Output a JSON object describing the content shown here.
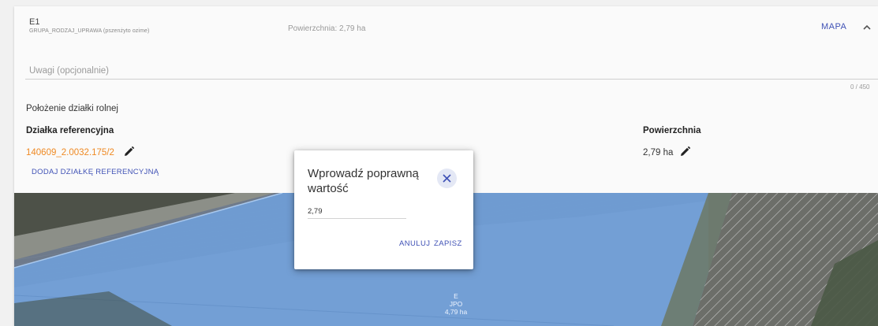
{
  "header": {
    "parcel_id": "E1",
    "group_crop": "GRUPA_RODZAJ_UPRAWA (pszenżyto ozime)",
    "area_text": "Powierzchnia: 2,79 ha",
    "map_button": "MAPA",
    "collapse_icon": "chevron-up-icon"
  },
  "remarks": {
    "placeholder": "Uwagi (opcjonalnie)",
    "counter": "0 / 450"
  },
  "location": {
    "section_label": "Położenie działki rolnej",
    "ref_header": "Działka referencyjna",
    "area_header": "Powierzchnia",
    "ref_value": "140609_2.0032.175/2",
    "area_value": "2,79 ha",
    "edit_icon": "pencil-icon",
    "add_ref_button": "DODAJ DZIAŁKĘ REFERENCYJNĄ"
  },
  "map": {
    "label_line1": "E",
    "label_line2": "JPO",
    "label_line3": "4,79 ha"
  },
  "dialog": {
    "title": "Wprowadź poprawną wartość",
    "input_value": "2,79",
    "cancel_button": "ANULUJ",
    "save_button": "ZAPISZ",
    "close_icon": "close-icon"
  },
  "colors": {
    "accent": "#3f51b5",
    "reference_link": "#ef8a24",
    "parcel_fill": "#6f9fd8"
  }
}
